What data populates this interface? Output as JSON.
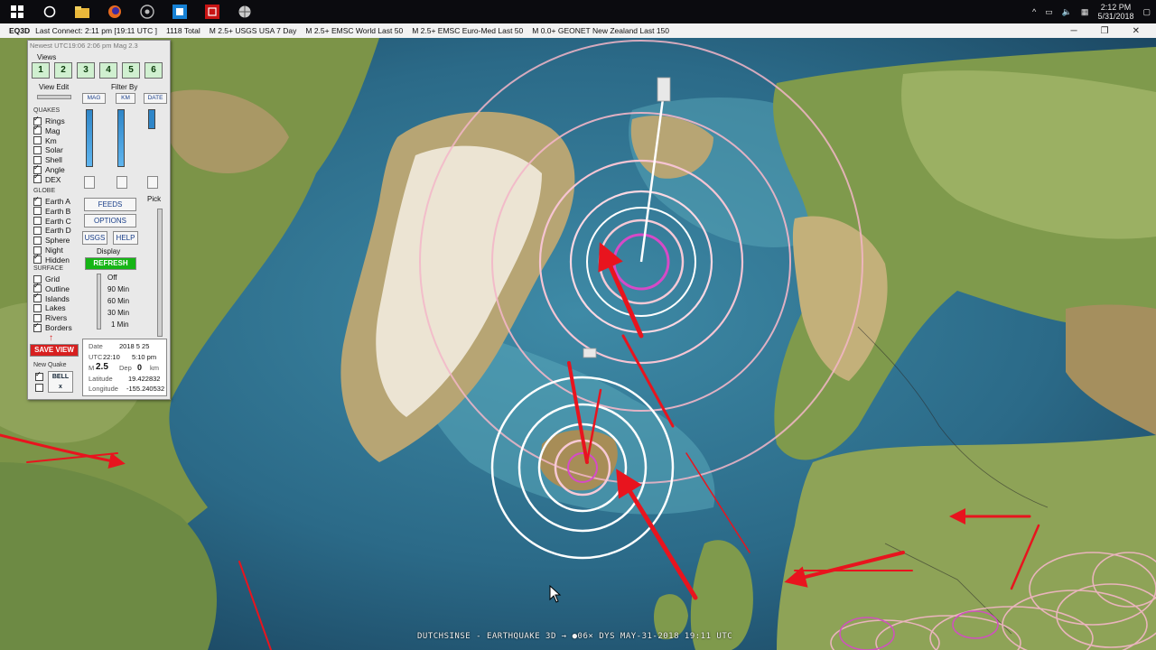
{
  "taskbar": {
    "icons": [
      "windows-start-icon",
      "cortana-search-icon",
      "file-explorer-icon",
      "firefox-icon",
      "chrome-icon",
      "app-blue-icon",
      "eq3d-red-icon",
      "globe-icon"
    ],
    "tray_chevron": "^",
    "time": "2:12 PM",
    "date": "5/31/2018"
  },
  "menubar": {
    "app": "EQ3D",
    "items": [
      "Last Connect: 2:11 pm  [19:11 UTC ]",
      "1118  Total",
      "M 2.5+  USGS USA 7 Day",
      "M 2.5+  EMSC World Last 50",
      "M 2.5+  EMSC Euro-Med Last 50",
      "M 0.0+  GEONET New Zealand Last 150"
    ],
    "minimize": "─",
    "maximize": "❐",
    "close": "✕"
  },
  "panel": {
    "newest": "Newest UTC19:06  2:06 pm  Mag 2.3",
    "views_label": "Views",
    "views": [
      "1",
      "2",
      "3",
      "4",
      "5",
      "6"
    ],
    "view_edit": "View Edit",
    "filter_by": "Filter By",
    "filter_buttons": [
      "MAG",
      "KM",
      "DATE"
    ],
    "quakes_label": "QUAKES",
    "quakes": [
      {
        "label": "Rings",
        "checked": true
      },
      {
        "label": "Mag",
        "checked": true
      },
      {
        "label": "Km",
        "checked": false
      },
      {
        "label": "Solar",
        "checked": false
      },
      {
        "label": "Shell",
        "checked": false
      },
      {
        "label": "Angle",
        "checked": true
      },
      {
        "label": "DEX",
        "checked": true
      }
    ],
    "globe_label": "GLOBE",
    "globe": [
      {
        "label": "Earth A",
        "checked": true
      },
      {
        "label": "Earth B",
        "checked": false
      },
      {
        "label": "Earth C",
        "checked": false
      },
      {
        "label": "Earth D",
        "checked": false
      },
      {
        "label": "Sphere",
        "checked": false
      },
      {
        "label": "Night",
        "checked": false
      },
      {
        "label": "Hidden",
        "checked": true
      }
    ],
    "surface_label": "SURFACE",
    "surface": [
      {
        "label": "Grid",
        "checked": false
      },
      {
        "label": "Outline",
        "checked": true
      },
      {
        "label": "Islands",
        "checked": true
      },
      {
        "label": "Lakes",
        "checked": false
      },
      {
        "label": "Rivers",
        "checked": false
      },
      {
        "label": "Borders",
        "checked": true
      }
    ],
    "feeds": "FEEDS",
    "options": "OPTIONS",
    "usgs": "USGS",
    "help": "HELP",
    "pick": "Pick",
    "display": "Display",
    "refresh": "REFRESH",
    "time_options": [
      "Off",
      "90 Min",
      "60 Min",
      "30 Min",
      "1 Min"
    ],
    "save_view": "SAVE VIEW",
    "new_quake": "New Quake",
    "bell": "BELL",
    "info": {
      "date_label": "Date",
      "date_value": "2018  5  25",
      "utc_label": "UTC",
      "utc_value": "22:10",
      "local_time": "5:10 pm",
      "mag_label": "M",
      "mag_value": "2.5",
      "dep_label": "Dep",
      "dep_value": "0",
      "dep_unit": "km",
      "lat_label": "Latitude",
      "lat_value": "19.422832",
      "lon_label": "Longitude",
      "lon_value": "-155.240532"
    }
  },
  "caption": "DUTCHSINSE - EARTHQUAKE 3D  →  ●06× DYS  MAY-31-2018  19:11 UTC",
  "colors": {
    "ocean_deep": "#1d4560",
    "ocean_shelf": "#4f9bb0",
    "land_green": "#6f8d45",
    "land_tan": "#b9a06a",
    "ice": "#e8e1d2",
    "ring_pink": "#f3b6c8",
    "ring_white": "#ffffff",
    "arrow_red": "#e8141e"
  }
}
